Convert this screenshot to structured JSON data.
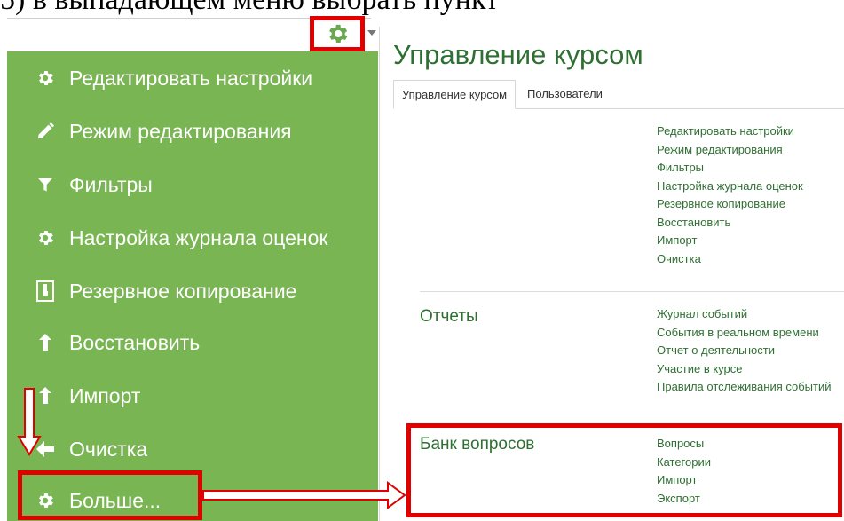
{
  "caption": {
    "text": "5) в выпадающем меню выбрать пункт"
  },
  "menu": {
    "items": [
      {
        "label": "Редактировать настройки",
        "icon": "gear-icon"
      },
      {
        "label": "Режим редактирования",
        "icon": "pencil-icon"
      },
      {
        "label": "Фильтры",
        "icon": "filter-icon"
      },
      {
        "label": "Настройка журнала оценок",
        "icon": "gear-icon"
      },
      {
        "label": "Резервное копирование",
        "icon": "archive-icon"
      },
      {
        "label": "Восстановить",
        "icon": "upload-icon"
      },
      {
        "label": "Импорт",
        "icon": "upload-icon"
      },
      {
        "label": "Очистка",
        "icon": "arrow-left-icon"
      },
      {
        "label": "Больше...",
        "icon": "gear-icon"
      }
    ]
  },
  "panel": {
    "title": "Управление курсом",
    "tabs": [
      {
        "label": "Управление курсом",
        "active": true
      },
      {
        "label": "Пользователи",
        "active": false
      }
    ],
    "sections": [
      {
        "heading": "",
        "links": [
          "Редактировать настройки",
          "Режим редактирования",
          "Фильтры",
          "Настройка журнала оценок",
          "Резервное копирование",
          "Восстановить",
          "Импорт",
          "Очистка"
        ]
      },
      {
        "heading": "Отчеты",
        "links": [
          "Журнал событий",
          "События в реальном времени",
          "Отчет о деятельности",
          "Участие в курсе",
          "Правила отслеживания событий"
        ]
      },
      {
        "heading": "Банк вопросов",
        "links": [
          "Вопросы",
          "Категории",
          "Импорт",
          "Экспорт"
        ]
      }
    ]
  },
  "colors": {
    "menu_bg": "#79b552",
    "accent_green": "#2f6f33",
    "highlight_red": "#e00000"
  }
}
